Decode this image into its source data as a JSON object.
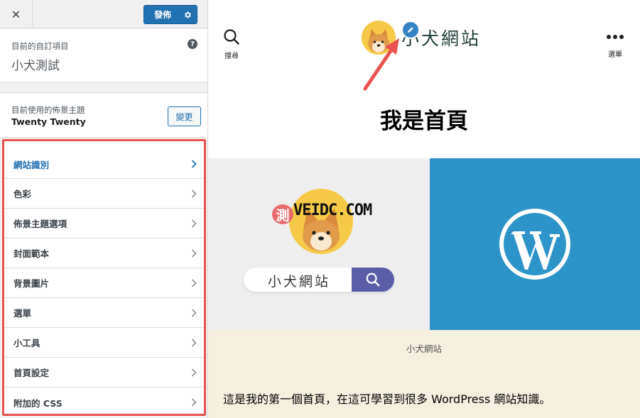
{
  "sidebar": {
    "close_label": "✕",
    "publish_label": "發佈",
    "current_label": "目前的自訂項目",
    "current_value": "小犬測試",
    "help_label": "?",
    "theme_label": "目前使用的佈景主題",
    "theme_name": "Twenty Twenty",
    "change_label": "變更",
    "items": [
      {
        "label": "網站識別",
        "active": true
      },
      {
        "label": "色彩"
      },
      {
        "label": "佈景主題選項"
      },
      {
        "label": "封面範本"
      },
      {
        "label": "背景圖片"
      },
      {
        "label": "選單"
      },
      {
        "label": "小工具"
      },
      {
        "label": "首頁設定"
      },
      {
        "label": "附加的 CSS"
      }
    ]
  },
  "preview": {
    "search_label": "搜尋",
    "menu_label": "選單",
    "site_title": "小犬網站",
    "page_heading": "我是首頁",
    "promo_ce": "測",
    "promo_text": "VEIDC.COM",
    "promo_search_text": "小犬網站",
    "caption": "小犬網站",
    "body_text": "這是我的第一個首頁，在這可學習到很多 WordPress 網站知識。"
  },
  "colors": {
    "accent": "#2271b1",
    "highlight_border": "#e8524f",
    "wp_blue": "#2d94c8",
    "caption_band": "#f5efe0"
  },
  "icons": [
    "close-icon",
    "gear-icon",
    "help-icon",
    "chevron-right-icon",
    "search-icon",
    "ellipsis-icon",
    "pencil-icon",
    "wordpress-logo-icon"
  ]
}
